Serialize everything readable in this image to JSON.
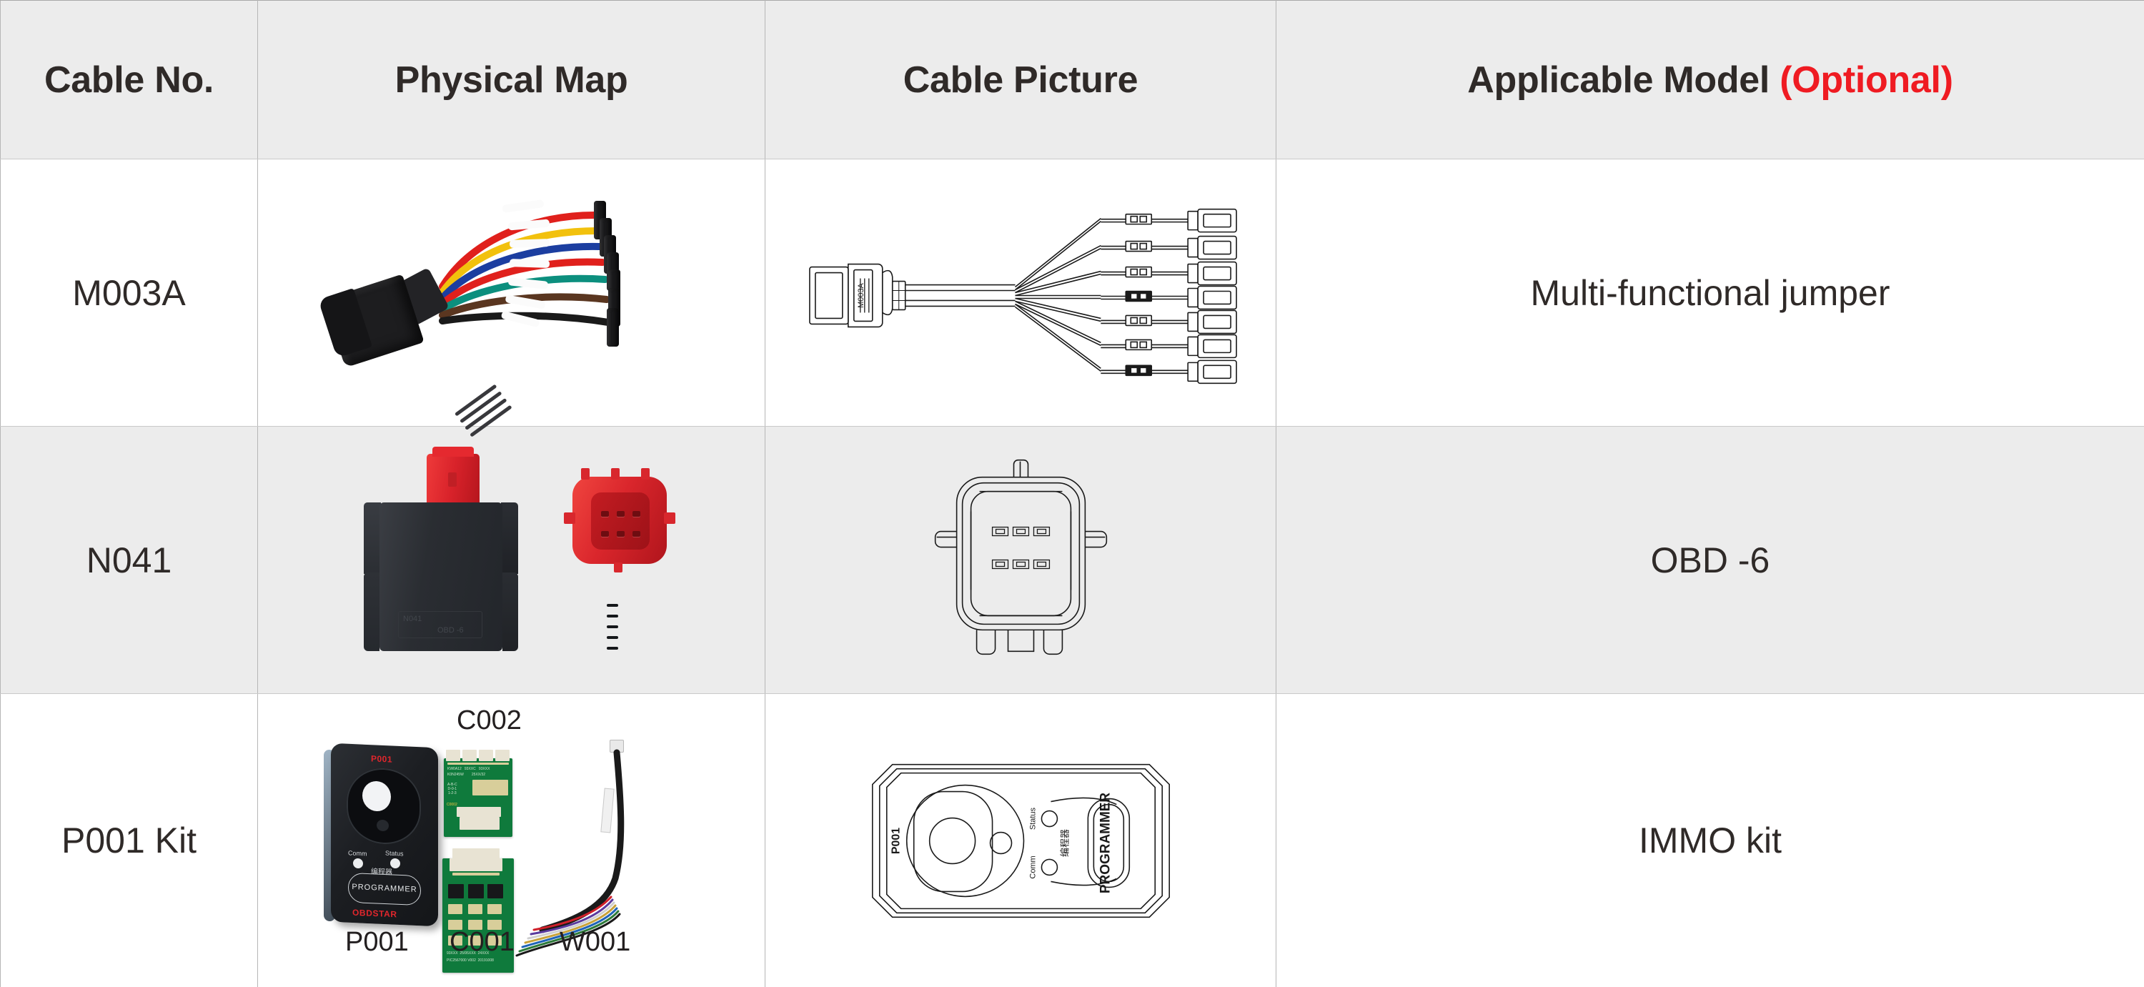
{
  "table": {
    "headers": [
      {
        "key": "cable_no",
        "label": "Cable No."
      },
      {
        "key": "physical",
        "label": "Physical Map"
      },
      {
        "key": "picture",
        "label": "Cable Picture"
      },
      {
        "key": "model",
        "label": "Applicable Model ",
        "suffix": "(Optional)",
        "suffix_color": "#ef1b22"
      }
    ],
    "rows": [
      {
        "cable_no": "M003A",
        "model": "Multi-functional jumper",
        "row_shade": "white",
        "physical_map": {
          "type": "photo",
          "description": "black OBD connector with seven colored jumper wires and black pin terminals",
          "wire_colors": [
            "#e0201c",
            "#f2c10d",
            "#1c3ea0",
            "#e0201c",
            "#0c8f7e",
            "#5a3620",
            "#1a1a1a"
          ],
          "connector_color": "#1d1d1f",
          "sleeve_color": "#ffffff"
        },
        "cable_picture": {
          "type": "linedraw",
          "connector_label": "M003A",
          "branch_count": 7,
          "description": "OBD connector with seven fanned-out wires each ending in a terminal"
        }
      },
      {
        "cable_no": "N041",
        "model": "OBD -6",
        "row_shade": "gray",
        "physical_map": {
          "type": "photo",
          "description": "black OBD adapter body with red connector on top and a separate red 6-pin connector",
          "body_color": "#2a2d32",
          "connector_color": "#d8272d",
          "emboss_text": [
            "N041",
            "OBD -6"
          ]
        },
        "cable_picture": {
          "type": "linedraw",
          "pin_count": 6,
          "pin_rows": 2,
          "pin_cols": 3,
          "description": "front view outline of a 6-pin rounded square connector with side tabs and latch"
        }
      },
      {
        "cable_no": "P001 Kit",
        "model": "IMMO kit",
        "row_shade": "white",
        "physical_map": {
          "type": "photo",
          "description": "P001 programmer with C002 and C001 adapter boards and a W001 wiring harness",
          "top_label": "C002",
          "bottom_labels": [
            "P001",
            "C001",
            "W001"
          ],
          "device": {
            "model_badge": "P001",
            "led_labels": [
              "Comm",
              "Status"
            ],
            "button_label": "PROGRAMMER",
            "cn_label": "编程器",
            "brand": "OBDSTAR",
            "accent_color": "#e2262c"
          },
          "harness_wire_colors": [
            "#d0202a",
            "#5b3b9e",
            "#1a1a1a",
            "#cfcfcf",
            "#c8a23a",
            "#1f64b8",
            "#2d7a3a"
          ]
        },
        "cable_picture": {
          "type": "linedraw",
          "device_label": "P001",
          "led_labels": [
            "Status",
            "Comm"
          ],
          "cn_label": "编程器",
          "button_label": "PROGRAMMER",
          "description": "rotated outline of the P001 programmer housing"
        }
      }
    ]
  },
  "style": {
    "header_bg": "#ececec",
    "row_alt_bg": "#ececec",
    "row_bg": "#ffffff",
    "border_color": "#b6b6b6",
    "text_color": "#2f2a28",
    "accent_red": "#ef1b22"
  }
}
